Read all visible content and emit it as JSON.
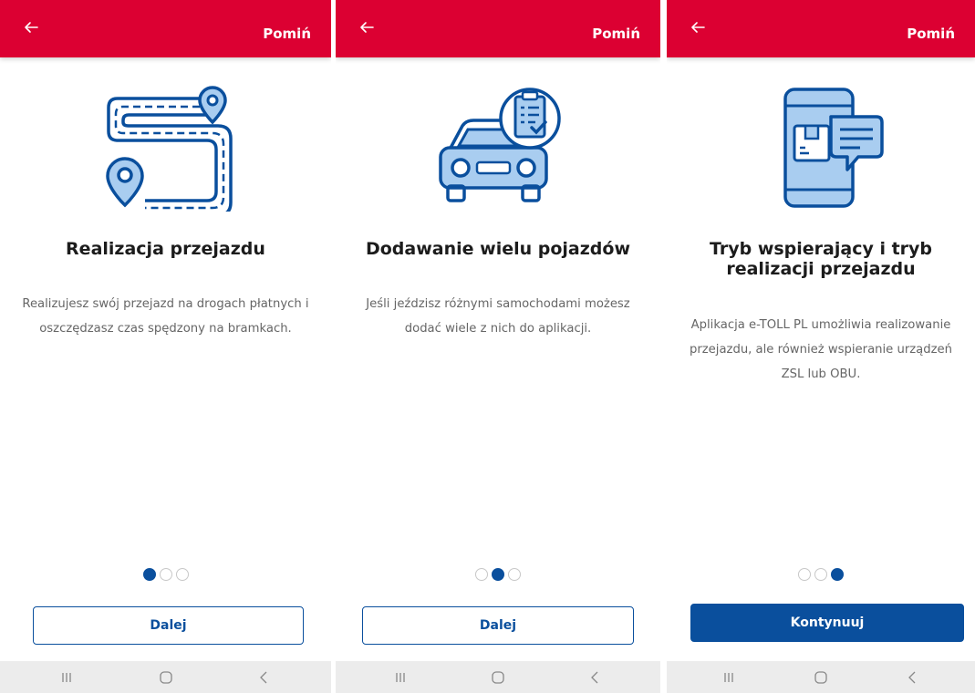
{
  "colors": {
    "brand_red": "#dc0032",
    "primary_blue": "#0a4f9d",
    "illustration_fill": "#a9cdf0"
  },
  "screens": [
    {
      "skip_label": "Pomiń",
      "illustration_icon": "route-map-icon",
      "title": "Realizacja przejazdu",
      "description": "Realizujesz swój przejazd na drogach płatnych i oszczędzasz czas spędzony na bramkach.",
      "page_index": 1,
      "page_count": 3,
      "button_label": "Dalej"
    },
    {
      "skip_label": "Pomiń",
      "illustration_icon": "car-checklist-icon",
      "title": "Dodawanie wielu pojazdów",
      "description": "Jeśli jeździsz różnymi samochodami możesz dodać wiele z nich do aplikacji.",
      "page_index": 2,
      "page_count": 3,
      "button_label": "Dalej"
    },
    {
      "skip_label": "Pomiń",
      "illustration_icon": "phone-message-icon",
      "title": "Tryb wspierający i tryb realizacji przejazdu",
      "description": "Aplikacja e-TOLL PL umożliwia realizowanie przejazdu, ale również wspieranie urządzeń ZSL lub OBU.",
      "page_index": 3,
      "page_count": 3,
      "button_label": "Kontynuuj"
    }
  ]
}
